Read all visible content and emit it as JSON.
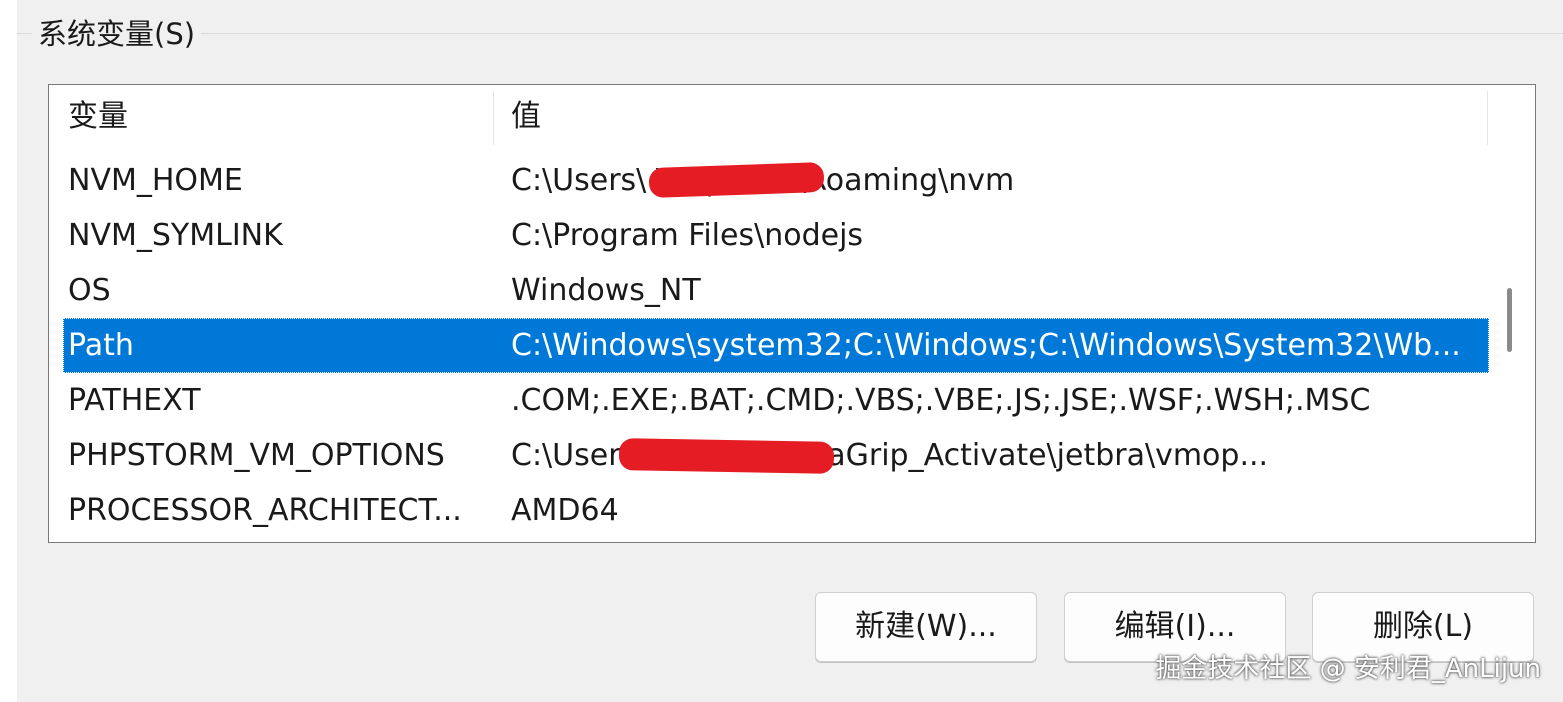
{
  "group": {
    "title": "系统变量(S)"
  },
  "table": {
    "columns": {
      "variable": "变量",
      "value": "值"
    },
    "rows": [
      {
        "variable": "NVM_HOME",
        "value": "C:\\Users\\                \\AppData\\Roaming\\nvm",
        "selected": false,
        "redacted": true
      },
      {
        "variable": "NVM_SYMLINK",
        "value": "C:\\Program Files\\nodejs",
        "selected": false,
        "redacted": false
      },
      {
        "variable": "OS",
        "value": "Windows_NT",
        "selected": false,
        "redacted": false
      },
      {
        "variable": "Path",
        "value": "C:\\Windows\\system32;C:\\Windows;C:\\Windows\\System32\\Wb...",
        "selected": true,
        "redacted": false
      },
      {
        "variable": "PATHEXT",
        "value": ".COM;.EXE;.BAT;.CMD;.VBS;.VBE;.JS;.JSE;.WSF;.WSH;.MSC",
        "selected": false,
        "redacted": false
      },
      {
        "variable": "PHPSTORM_VM_OPTIONS",
        "value": "C:\\User                    \\Desktop\\DataGrip_Activate\\jetbra\\vmop...",
        "selected": false,
        "redacted": true
      },
      {
        "variable": "PROCESSOR_ARCHITECT...",
        "value": "AMD64",
        "selected": false,
        "redacted": false
      }
    ]
  },
  "buttons": {
    "new": "新建(W)...",
    "edit": "编辑(I)...",
    "delete": "删除(L)"
  },
  "watermark": "掘金技术社区 @ 安利君_AnLijun",
  "colors": {
    "selection": "#0078d7",
    "redaction": "#e51c23",
    "panel": "#f0f0f0"
  }
}
